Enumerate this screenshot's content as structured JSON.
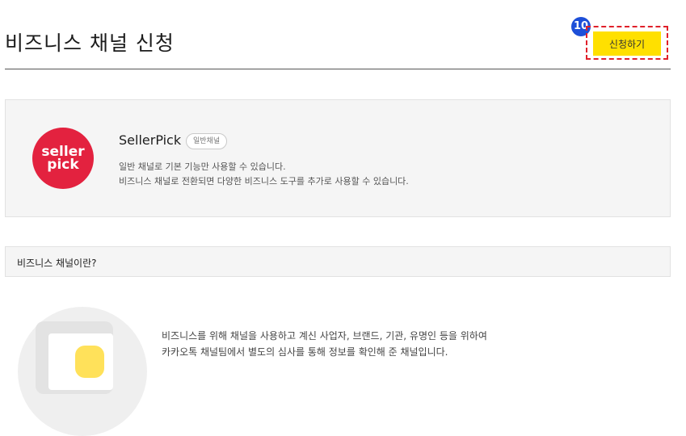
{
  "header": {
    "title": "비즈니스 채널 신청",
    "step_number": "10",
    "apply_label": "신청하기"
  },
  "profile": {
    "logo_line1": "seller",
    "logo_line2": "pick",
    "name": "SellerPick",
    "badge": "일반채널",
    "desc_line1": "일반 채널로 기본 기능만 사용할 수 있습니다.",
    "desc_line2": "비즈니스 채널로 전환되면 다양한 비즈니스 도구를 추가로 사용할 수 있습니다."
  },
  "section": {
    "header": "비즈니스 채널이란?"
  },
  "info": {
    "line1": "비즈니스를 위해 채널을 사용하고 계신 사업자, 브랜드, 기관, 유명인 등을 위하여",
    "line2": "카카오톡 채널팀에서 별도의 심사를 통해 정보를 확인해 준 채널입니다."
  },
  "colors": {
    "accent_yellow": "#ffe000",
    "logo_red": "#e3223f",
    "badge_blue": "#1d4fd8",
    "highlight_red": "#e0202a"
  }
}
